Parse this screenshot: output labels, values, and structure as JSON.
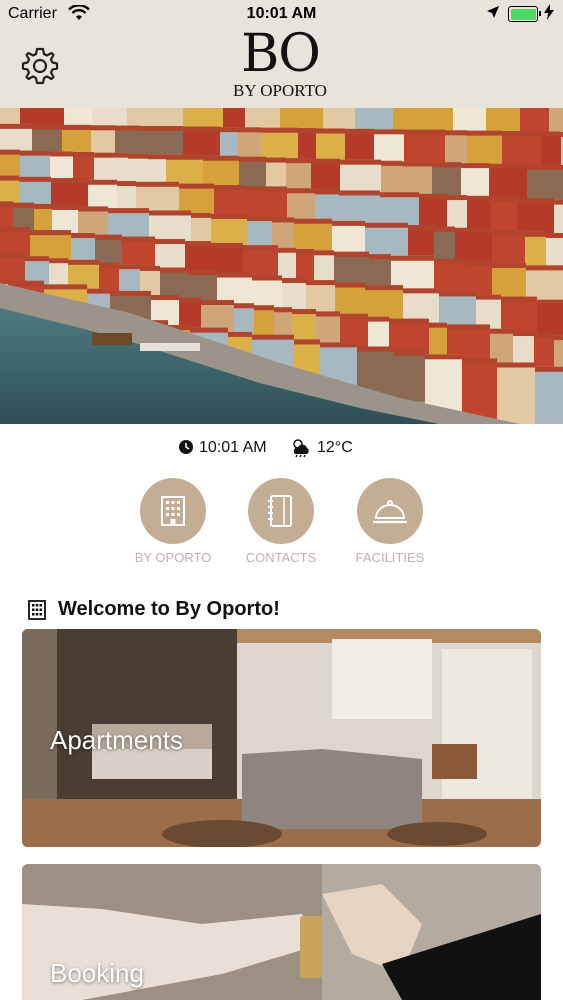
{
  "status_bar": {
    "carrier": "Carrier",
    "time": "10:01 AM",
    "battery_level": 1.0
  },
  "header": {
    "logo_initials": "BO",
    "logo_subtitle": "BY OPORTO",
    "settings_icon": "gear-icon"
  },
  "hero": {
    "description": "aerial view of Porto riverside"
  },
  "info": {
    "time": "10:01 AM",
    "temperature": "12°C",
    "clock_icon": "clock-icon",
    "weather_icon": "weather-cloud-icon"
  },
  "quick_links": [
    {
      "label": "BY OPORTO",
      "icon": "building-icon"
    },
    {
      "label": "CONTACTS",
      "icon": "contacts-book-icon"
    },
    {
      "label": "FACILITIES",
      "icon": "service-bell-icon"
    }
  ],
  "section": {
    "title": "Welcome to By Oporto!",
    "icon": "building-icon"
  },
  "cards": [
    {
      "label": "Apartments"
    },
    {
      "label": "Booking"
    }
  ],
  "colors": {
    "header_bg": "#e8e4dc",
    "accent": "#c4ad95",
    "label": "#c0b2a6"
  }
}
